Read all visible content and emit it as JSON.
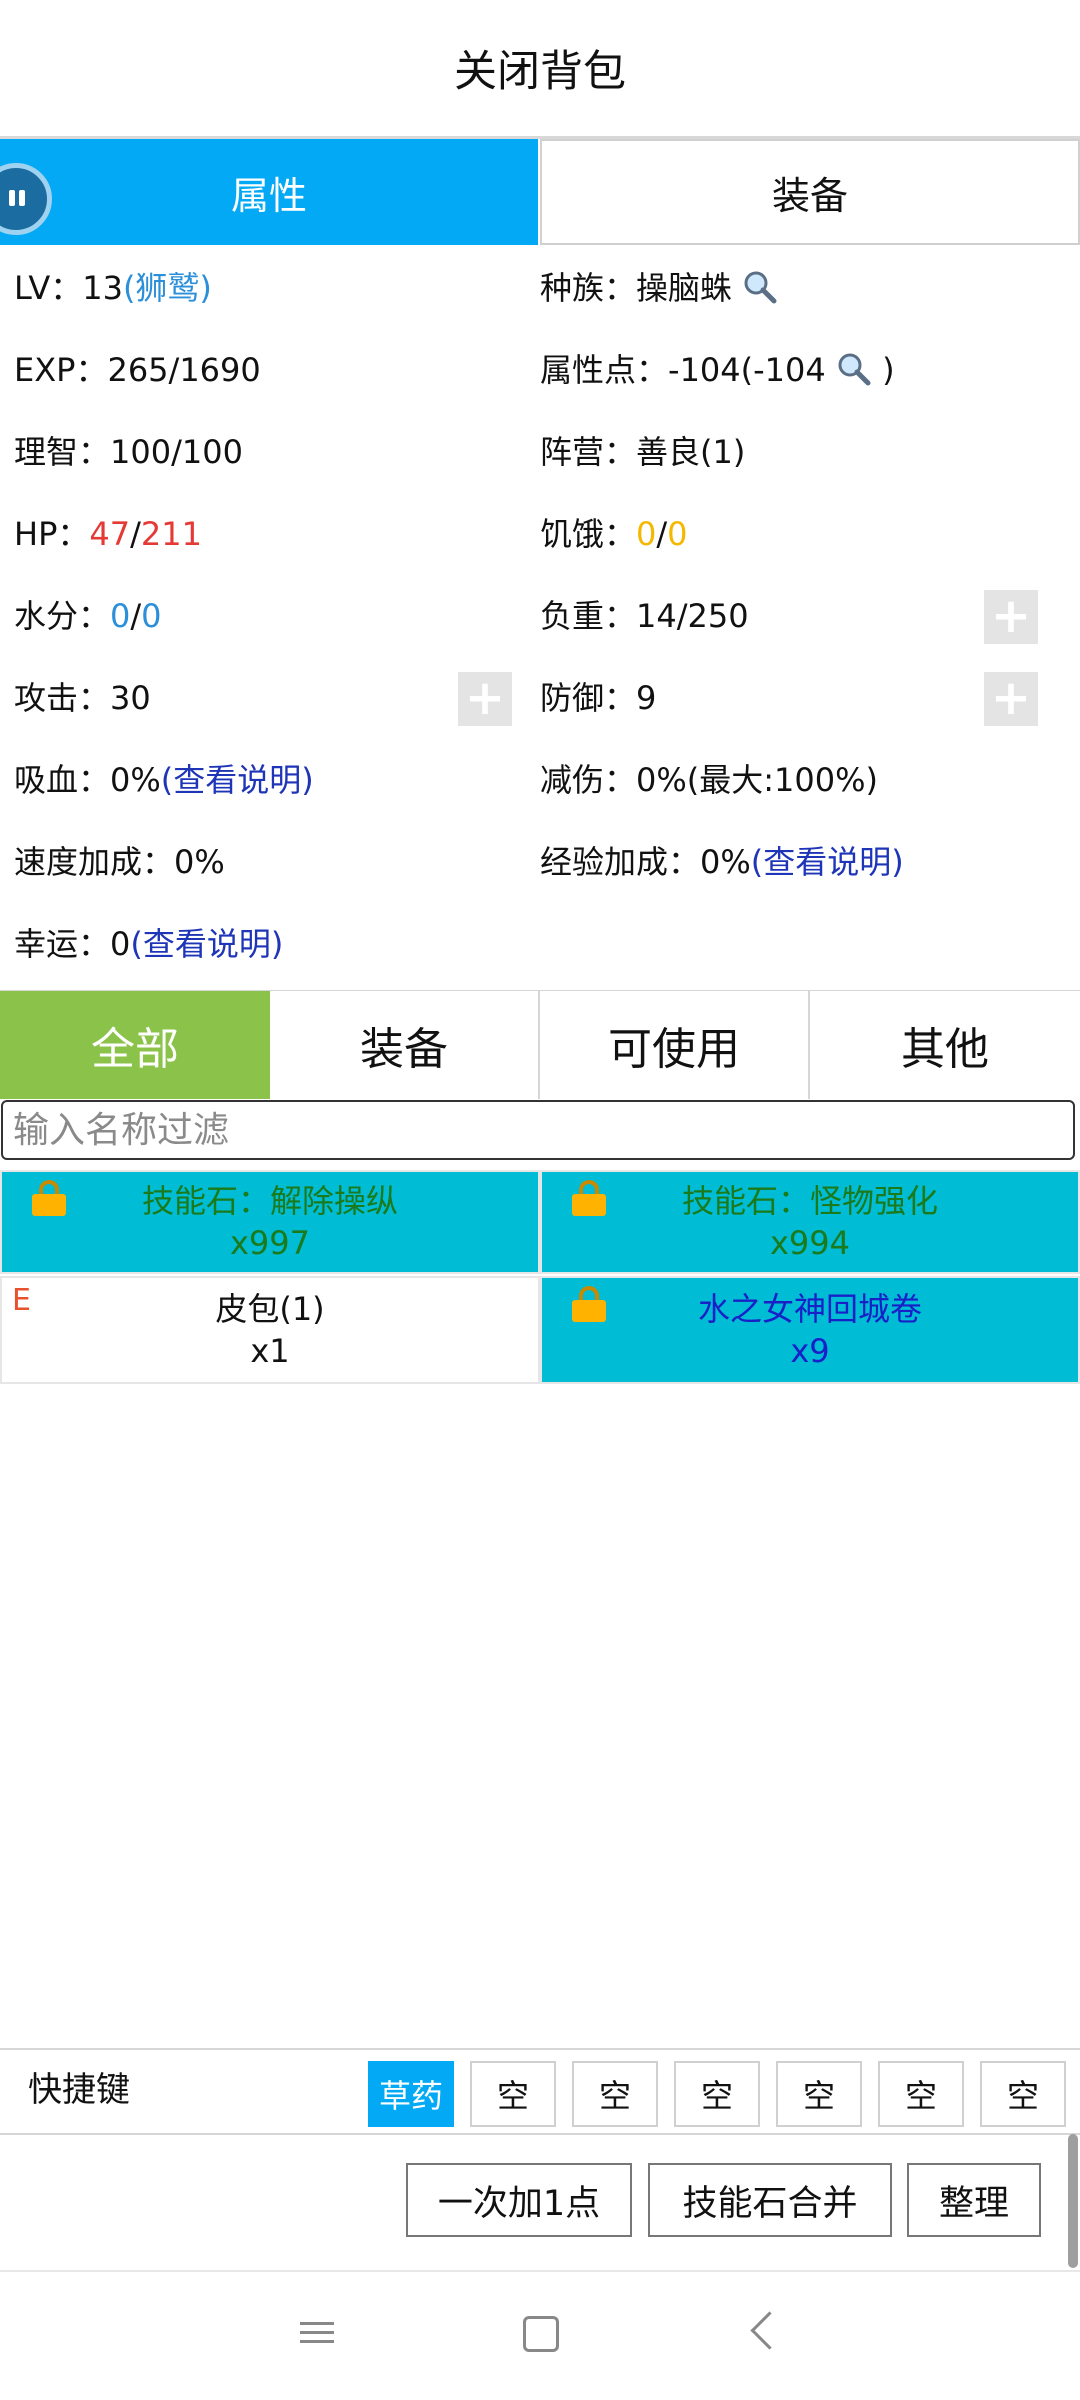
{
  "title": "关闭背包",
  "tabs": {
    "attributes": "属性",
    "equipment": "装备"
  },
  "attributes": {
    "lv": {
      "label": "LV：",
      "value": "13",
      "note": "(狮鹫)"
    },
    "race": {
      "label": "种族：",
      "value": "操脑蛛",
      "icon": "search-icon"
    },
    "exp": {
      "label": "EXP：",
      "value": "265/1690"
    },
    "points": {
      "label": "属性点：",
      "value": "-104(-104",
      "suffix": ")",
      "icon": "search-icon"
    },
    "sanity": {
      "label": "理智：",
      "value": "100/100"
    },
    "camp": {
      "label": "阵营：",
      "value": "善良(1)"
    },
    "hp": {
      "label": "HP：",
      "current": "47",
      "sep": "/",
      "max": "211"
    },
    "hunger": {
      "label": "饥饿：",
      "current": "0",
      "sep": "/",
      "max": "0"
    },
    "water": {
      "label": "水分：",
      "current": "0",
      "sep": "/",
      "max": "0"
    },
    "load": {
      "label": "负重：",
      "value": "14/250"
    },
    "attack": {
      "label": "攻击：",
      "value": "30"
    },
    "defense": {
      "label": "防御：",
      "value": "9"
    },
    "lifesteal": {
      "label": "吸血：",
      "value": "0%",
      "link": "(查看说明)"
    },
    "reduction": {
      "label": "减伤：",
      "value": "0%(最大:100%)"
    },
    "speed": {
      "label": "速度加成：",
      "value": "0%"
    },
    "exp_bonus": {
      "label": "经验加成：",
      "value": "0%",
      "link": "(查看说明)"
    },
    "luck": {
      "label": "幸运：",
      "value": "0",
      "link": "(查看说明)"
    },
    "plus_symbol": "+"
  },
  "categories": [
    "全部",
    "装备",
    "可使用",
    "其他"
  ],
  "filter": {
    "placeholder": "输入名称过滤",
    "value": ""
  },
  "items": [
    {
      "name": "技能石：解除操纵",
      "count": "x997",
      "locked": true
    },
    {
      "name": "技能石：怪物强化",
      "count": "x994",
      "locked": true
    },
    {
      "name": "皮包(1)",
      "count": "x1",
      "tag": "E",
      "locked": false
    },
    {
      "name": "水之女神回城卷",
      "count": "x9",
      "locked": true
    }
  ],
  "colors": {
    "accent": "#03a9f4",
    "category_active": "#8bc34a",
    "item_bg": "#00bcd4",
    "item_text_green": "#1b7a1b",
    "item_text_blue": "#1a20c8",
    "hp": "#e53935",
    "hunger": "#f5b800",
    "water": "#2b8fd9",
    "link": "#1f35b8"
  },
  "quickbar": {
    "label": "快捷键",
    "slots": [
      "草药",
      "空",
      "空",
      "空",
      "空",
      "空",
      "空"
    ]
  },
  "actions": {
    "add_one": "一次加1点",
    "merge": "技能石合并",
    "sort": "整理"
  }
}
